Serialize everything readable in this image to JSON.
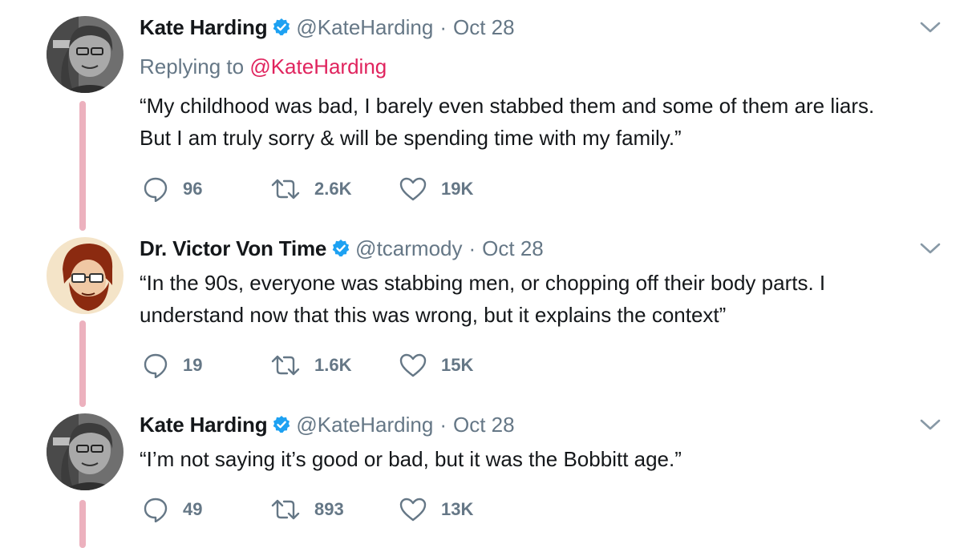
{
  "tweets": [
    {
      "name": "Kate Harding",
      "handle": "@KateHarding",
      "separator": "·",
      "date": "Oct 28",
      "reply_prefix": "Replying to",
      "reply_mention": "@KateHarding",
      "lines": [
        "“My childhood was bad, I barely even stabbed them and some of them are liars.",
        "But I am truly sorry & will be spending time with my family.”"
      ],
      "replies": "96",
      "retweets": "2.6K",
      "likes": "19K"
    },
    {
      "name": "Dr. Victor Von Time",
      "handle": "@tcarmody",
      "separator": "·",
      "date": "Oct 28",
      "lines": [
        "“In the 90s, everyone was stabbing men, or chopping off their body parts. I",
        "understand now that this was wrong, but it explains the context”"
      ],
      "replies": "19",
      "retweets": "1.6K",
      "likes": "15K"
    },
    {
      "name": "Kate Harding",
      "handle": "@KateHarding",
      "separator": "·",
      "date": "Oct 28",
      "lines": [
        "“I’m not saying it’s good or bad, but it was the Bobbitt age.”"
      ],
      "replies": "49",
      "retweets": "893",
      "likes": "13K"
    }
  ],
  "colors": {
    "verified": "#1da1f2",
    "mention": "#e0245e",
    "thread_line": "#ecb1be",
    "muted": "#657786"
  }
}
